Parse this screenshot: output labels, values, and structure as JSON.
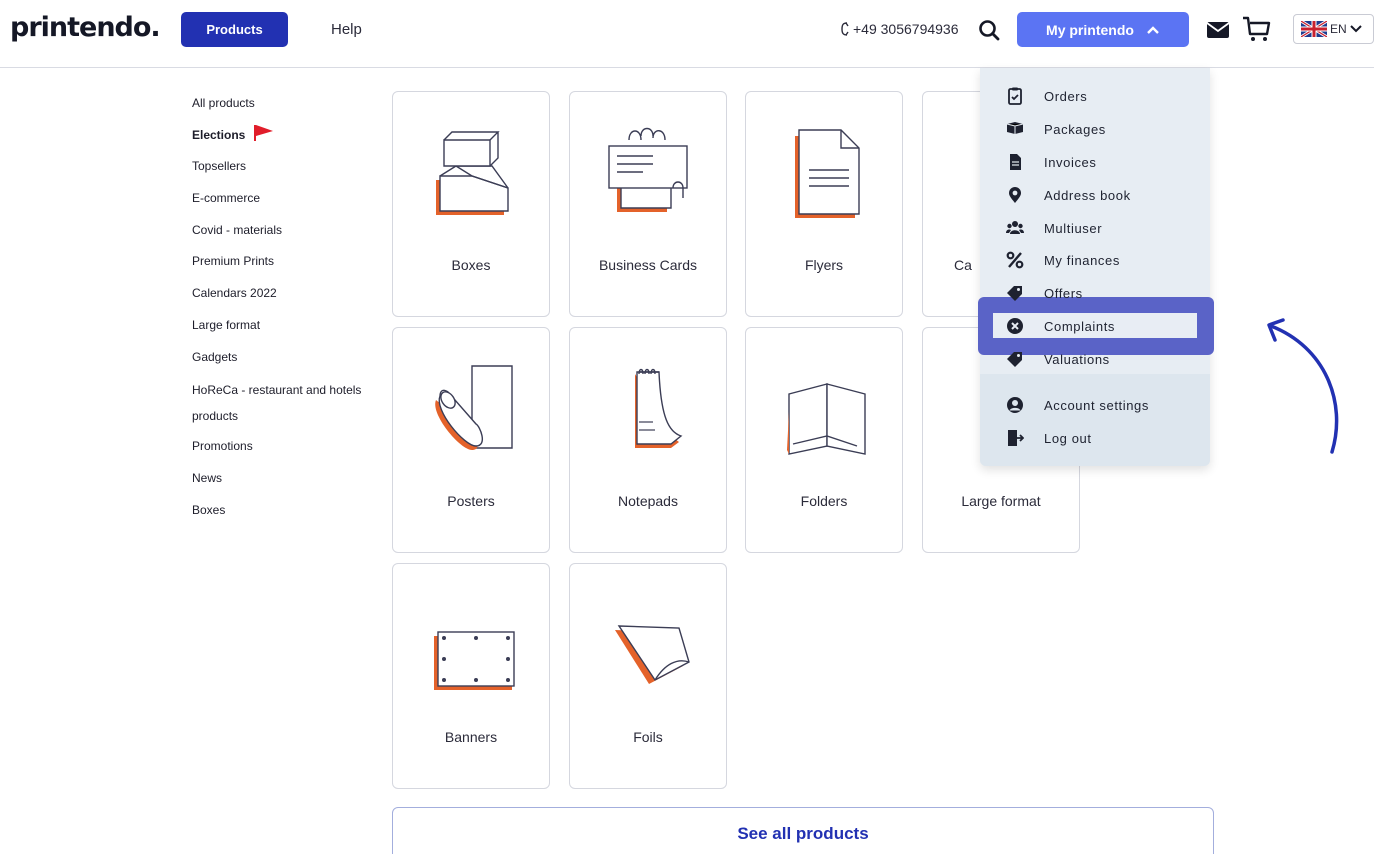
{
  "header": {
    "logo": "printendo.",
    "products_label": "Products",
    "help_label": "Help",
    "phone": "+49 3056794936",
    "my_label": "My printendo",
    "language": "EN"
  },
  "sidebar": {
    "items": [
      {
        "label": "All products"
      },
      {
        "label": "Elections"
      },
      {
        "label": "Topsellers"
      },
      {
        "label": "E-commerce"
      },
      {
        "label": "Covid - materials"
      },
      {
        "label": "Premium Prints"
      },
      {
        "label": "Calendars 2022"
      },
      {
        "label": "Large format"
      },
      {
        "label": "Gadgets"
      },
      {
        "label": "HoReCa - restaurant and hotels products"
      },
      {
        "label": "Promotions"
      },
      {
        "label": "News"
      },
      {
        "label": "Boxes"
      }
    ]
  },
  "products": [
    {
      "label": "Boxes",
      "icon": "box-icon"
    },
    {
      "label": "Business Cards",
      "icon": "business-card-icon"
    },
    {
      "label": "Flyers",
      "icon": "flyer-icon"
    },
    {
      "label": "Ca",
      "icon": "catalog-icon"
    },
    {
      "label": "Posters",
      "icon": "poster-icon"
    },
    {
      "label": "Notepads",
      "icon": "notepad-icon"
    },
    {
      "label": "Folders",
      "icon": "folder-icon"
    },
    {
      "label": "Large format",
      "icon": "large-format-icon"
    },
    {
      "label": "Banners",
      "icon": "banner-icon"
    },
    {
      "label": "Foils",
      "icon": "foil-icon"
    }
  ],
  "see_all_label": "See all products",
  "menu": {
    "items": [
      {
        "label": "Orders",
        "icon": "clipboard-check-icon"
      },
      {
        "label": "Packages",
        "icon": "package-icon"
      },
      {
        "label": "Invoices",
        "icon": "invoice-icon"
      },
      {
        "label": "Address book",
        "icon": "map-pin-icon"
      },
      {
        "label": "Multiuser",
        "icon": "users-icon"
      },
      {
        "label": "My finances",
        "icon": "percent-icon"
      },
      {
        "label": "Offers",
        "icon": "tag-icon"
      },
      {
        "label": "Complaints",
        "icon": "x-circle-icon"
      },
      {
        "label": "Valuations",
        "icon": "tag-icon"
      },
      {
        "label": "Account settings",
        "icon": "user-icon"
      },
      {
        "label": "Log out",
        "icon": "logout-icon"
      }
    ],
    "highlighted": "Complaints"
  },
  "colors": {
    "primary": "#2231b2",
    "accent": "#5b74f3",
    "highlight": "#5a63c7",
    "orange": "#e4622a",
    "arrow": "#2231b2"
  }
}
